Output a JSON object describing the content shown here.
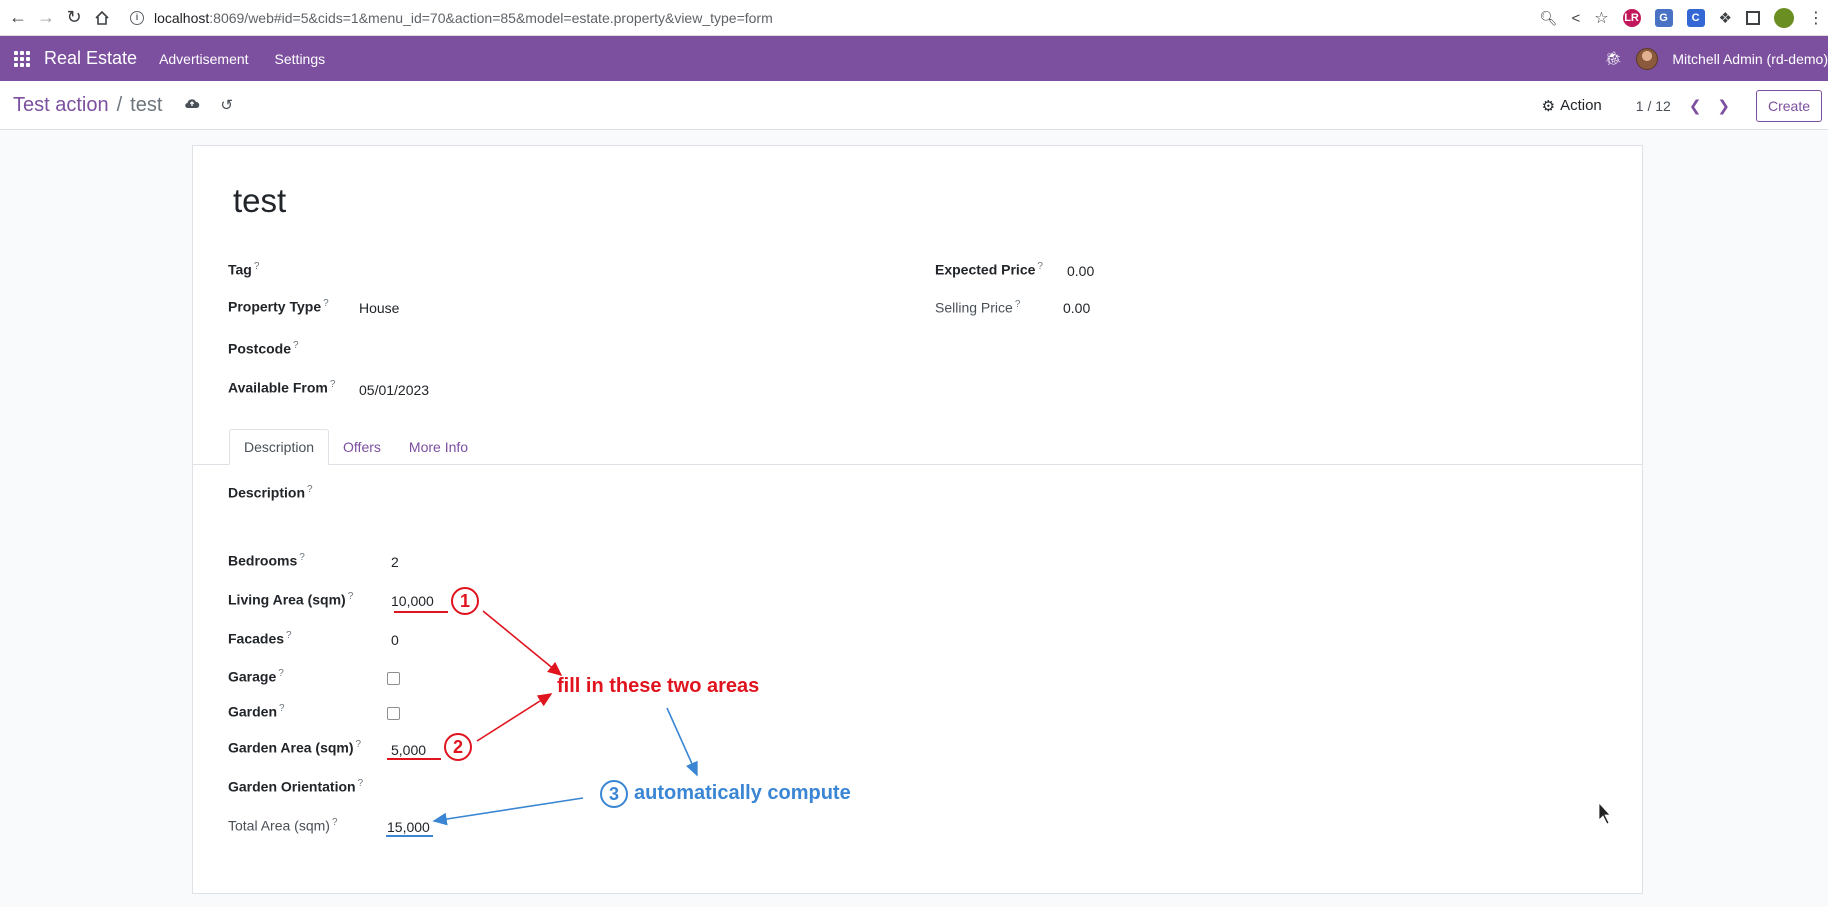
{
  "browser": {
    "url_host": "localhost",
    "url_path": ":8069/web#id=5&cids=1&menu_id=70&action=85&model=estate.property&view_type=form"
  },
  "navbar": {
    "brand": "Real Estate",
    "menu": [
      "Advertisement",
      "Settings"
    ],
    "user": "Mitchell Admin (rd-demo)"
  },
  "control_panel": {
    "breadcrumb_parent": "Test action",
    "breadcrumb_sep": "/",
    "breadcrumb_current": "test",
    "action_label": "Action",
    "pager": "1 / 12",
    "create_label": "Create"
  },
  "form": {
    "title": "test",
    "fields_left": {
      "tag": {
        "label": "Tag",
        "value": ""
      },
      "property_type": {
        "label": "Property Type",
        "value": "House"
      },
      "postcode": {
        "label": "Postcode",
        "value": ""
      },
      "available_from": {
        "label": "Available From",
        "value": "05/01/2023"
      }
    },
    "fields_right": {
      "expected_price": {
        "label": "Expected Price",
        "value": "0.00"
      },
      "selling_price": {
        "label": "Selling Price",
        "value": "0.00"
      }
    },
    "tabs": [
      "Description",
      "Offers",
      "More Info"
    ],
    "description": {
      "description": {
        "label": "Description",
        "value": ""
      },
      "bedrooms": {
        "label": "Bedrooms",
        "value": "2"
      },
      "living_area": {
        "label": "Living Area (sqm)",
        "value": "10,000"
      },
      "facades": {
        "label": "Facades",
        "value": "0"
      },
      "garage": {
        "label": "Garage",
        "checked": false
      },
      "garden": {
        "label": "Garden",
        "checked": false
      },
      "garden_area": {
        "label": "Garden Area (sqm)",
        "value": "5,000"
      },
      "garden_orientation": {
        "label": "Garden Orientation",
        "value": ""
      },
      "total_area": {
        "label": "Total Area (sqm)",
        "value": "15,000"
      }
    },
    "help_marker": "?"
  },
  "annotations": {
    "step1": "1",
    "step2": "2",
    "step3": "3",
    "fill_text": "fill in these two areas",
    "compute_text": "automatically compute",
    "red_color": "#e0141e",
    "blue_color": "#3a86d4"
  }
}
